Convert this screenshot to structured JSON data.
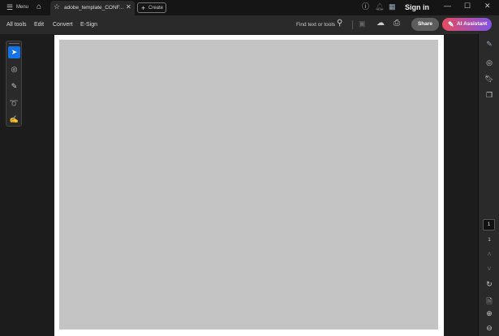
{
  "titlebar": {
    "menu_label": "Menu",
    "tab_title": "adobe_template_CONF...",
    "create_label": "Create",
    "sign_in": "Sign in"
  },
  "toolbar": {
    "items": [
      "All tools",
      "Edit",
      "Convert",
      "E-Sign"
    ],
    "find_placeholder": "Find text or tools",
    "share": "Share",
    "ai_assistant": "AI Assistant"
  },
  "rail": {
    "page_current": "1",
    "page_total": "1"
  },
  "colors": {
    "accent": "#1473e6",
    "ai_gradient_start": "#e84b5e",
    "ai_gradient_end": "#7e54e6"
  }
}
